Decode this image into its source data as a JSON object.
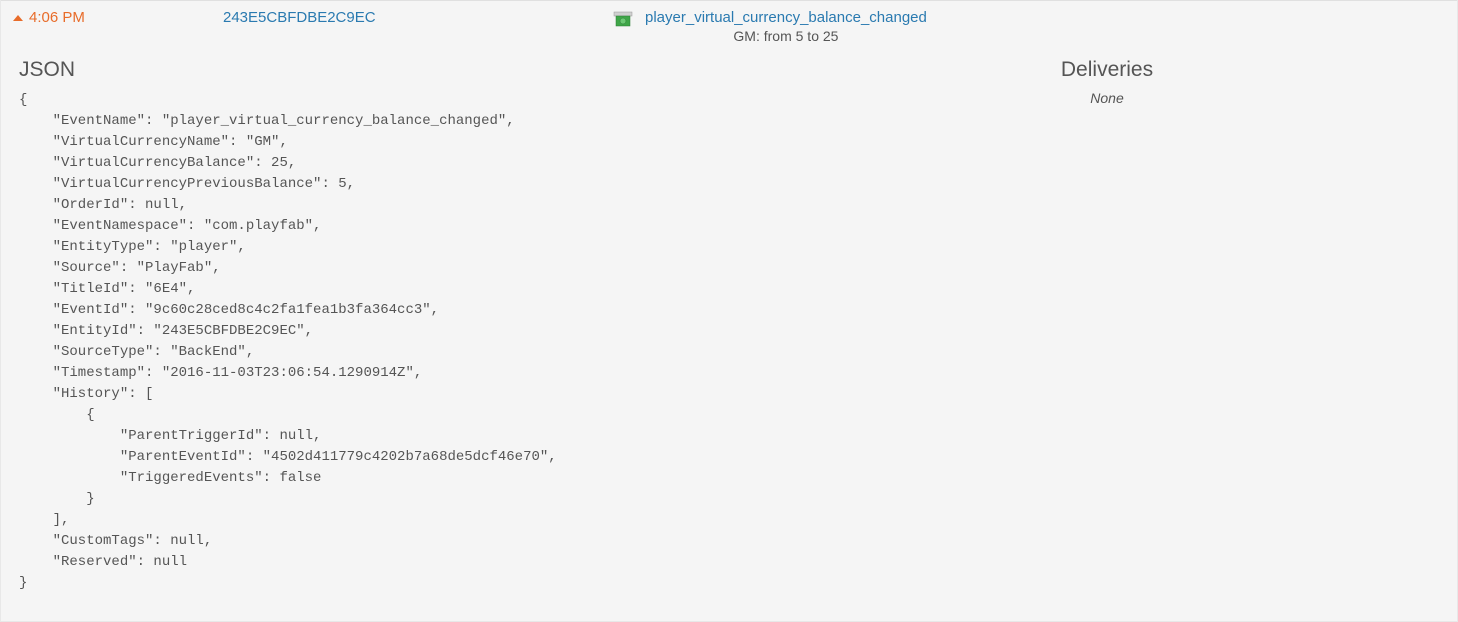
{
  "header": {
    "time": "4:06 PM",
    "entity_id": "243E5CBFDBE2C9EC",
    "event_name": "player_virtual_currency_balance_changed",
    "event_subtitle": "GM: from 5 to 25"
  },
  "panels": {
    "json_title": "JSON",
    "deliveries_title": "Deliveries",
    "deliveries_status": "None"
  },
  "json_body": "{\n    \"EventName\": \"player_virtual_currency_balance_changed\",\n    \"VirtualCurrencyName\": \"GM\",\n    \"VirtualCurrencyBalance\": 25,\n    \"VirtualCurrencyPreviousBalance\": 5,\n    \"OrderId\": null,\n    \"EventNamespace\": \"com.playfab\",\n    \"EntityType\": \"player\",\n    \"Source\": \"PlayFab\",\n    \"TitleId\": \"6E4\",\n    \"EventId\": \"9c60c28ced8c4c2fa1fea1b3fa364cc3\",\n    \"EntityId\": \"243E5CBFDBE2C9EC\",\n    \"SourceType\": \"BackEnd\",\n    \"Timestamp\": \"2016-11-03T23:06:54.1290914Z\",\n    \"History\": [\n        {\n            \"ParentTriggerId\": null,\n            \"ParentEventId\": \"4502d411779c4202b7a68de5dcf46e70\",\n            \"TriggeredEvents\": false\n        }\n    ],\n    \"CustomTags\": null,\n    \"Reserved\": null\n}"
}
